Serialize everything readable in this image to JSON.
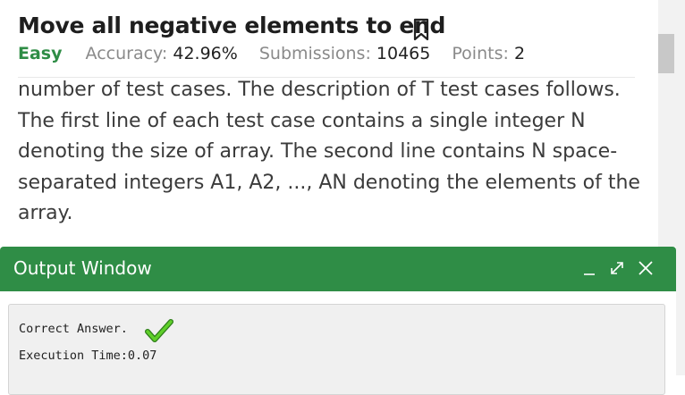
{
  "problem": {
    "title": "Move all negative elements to end",
    "difficulty": "Easy",
    "accuracy_label": "Accuracy:",
    "accuracy_value": "42.96%",
    "submissions_label": "Submissions:",
    "submissions_value": "10465",
    "points_label": "Points:",
    "points_value": "2",
    "description_lines": [
      "number of test cases. The description of T test cases follows.",
      "The first line of each test case contains a single integer N",
      "denoting the size of array. The second line contains N space-",
      "separated integers A1, A2, ..., AN denoting the elements of the",
      "array."
    ]
  },
  "output_window": {
    "title": "Output Window",
    "result_text": "Correct Answer.",
    "execution_time": "Execution Time:0.07"
  },
  "icons": {
    "bookmark": "bookmark-icon",
    "minimize": "minimize-icon",
    "expand": "expand-icon",
    "close": "close-icon",
    "check": "check-icon"
  },
  "colors": {
    "brand_green": "#2f8d46",
    "check_green": "#4cbb17"
  }
}
